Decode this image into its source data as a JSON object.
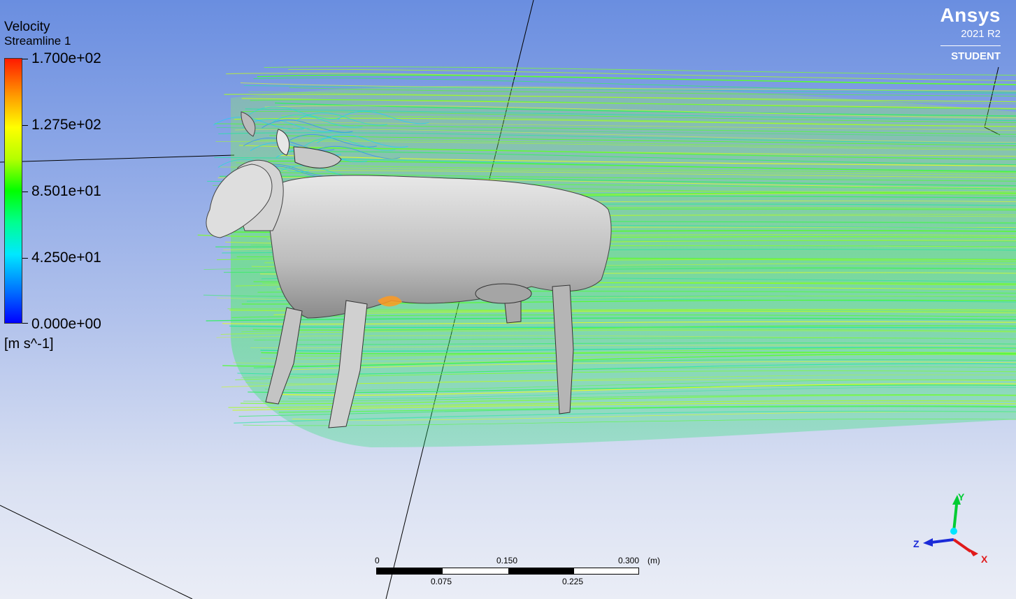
{
  "legend": {
    "title": "Velocity",
    "subtitle": "Streamline 1",
    "labels": [
      "1.700e+02",
      "1.275e+02",
      "8.501e+01",
      "4.250e+01",
      "0.000e+00"
    ],
    "unit": "[m s^-1]"
  },
  "logo": {
    "name": "Ansys",
    "version": "2021 R2",
    "edition": "STUDENT"
  },
  "scale": {
    "top_labels": [
      "0",
      "0.150",
      "0.300"
    ],
    "bottom_labels": [
      "0.075",
      "0.225"
    ],
    "unit": "(m)"
  },
  "axes": {
    "y": "Y",
    "z": "Z",
    "x": "X"
  },
  "colors": {
    "axis_y": "#00cc33",
    "axis_z": "#1b2bd8",
    "axis_x": "#e01b1b",
    "origin": "#00e5ff",
    "model_body": "#c8c8c8"
  }
}
